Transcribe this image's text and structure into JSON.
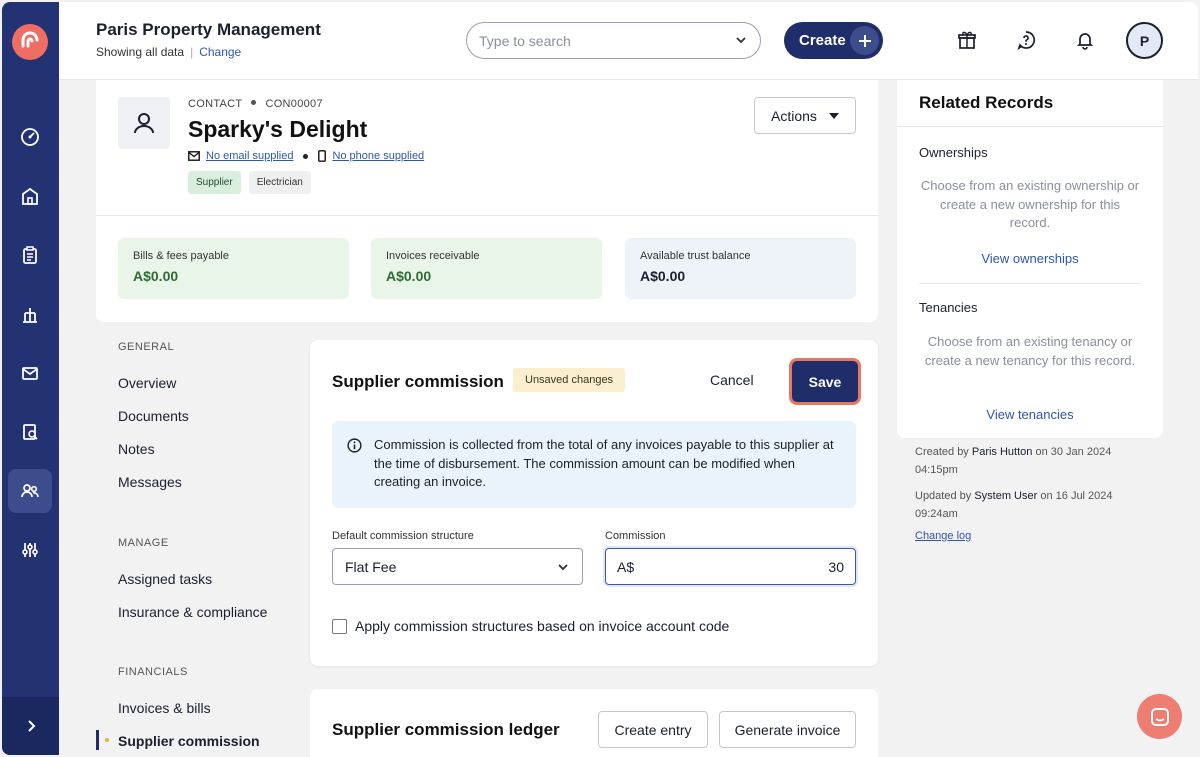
{
  "header": {
    "org_title": "Paris Property Management",
    "showing_text": "Showing all data",
    "change_link": "Change",
    "search_placeholder": "Type to search",
    "create_label": "Create",
    "avatar_initial": "P"
  },
  "contact": {
    "kind": "CONTACT",
    "code": "CON00007",
    "name": "Sparky's Delight",
    "email_text": "No email supplied",
    "phone_text": "No phone supplied",
    "tags": [
      "Supplier",
      "Electrician"
    ],
    "actions_label": "Actions",
    "stats": [
      {
        "label": "Bills & fees payable",
        "value": "A$0.00"
      },
      {
        "label": "Invoices receivable",
        "value": "A$0.00"
      },
      {
        "label": "Available trust balance",
        "value": "A$0.00"
      }
    ]
  },
  "sidenav": {
    "general_head": "GENERAL",
    "general": [
      "Overview",
      "Documents",
      "Notes",
      "Messages"
    ],
    "manage_head": "MANAGE",
    "manage": [
      "Assigned tasks",
      "Insurance & compliance"
    ],
    "financials_head": "FINANCIALS",
    "financials": [
      "Invoices & bills",
      "Supplier commission"
    ]
  },
  "commission": {
    "title": "Supplier commission",
    "unsaved_badge": "Unsaved changes",
    "cancel_label": "Cancel",
    "save_label": "Save",
    "info_text": "Commission is collected from the total of any invoices payable to this supplier at the time of disbursement. The commission amount can be modified when creating an invoice.",
    "structure_label": "Default commission structure",
    "structure_value": "Flat Fee",
    "commission_label": "Commission",
    "currency_prefix": "A$",
    "commission_value": "30",
    "checkbox_label": "Apply commission structures based on invoice account code",
    "checkbox_checked": false
  },
  "ledger": {
    "title": "Supplier commission ledger",
    "create_entry_label": "Create entry",
    "generate_invoice_label": "Generate invoice"
  },
  "related": {
    "title": "Related Records",
    "ownerships_title": "Ownerships",
    "ownerships_desc": "Choose from an existing ownership or create a new ownership for this record.",
    "ownerships_link": "View ownerships",
    "tenancies_title": "Tenancies",
    "tenancies_desc": "Choose from an existing tenancy or create a new tenancy for this record.",
    "tenancies_link": "View tenancies"
  },
  "meta": {
    "created_prefix": "Created by",
    "created_by": "Paris Hutton",
    "created_on": "on 30 Jan 2024 04:15pm",
    "updated_prefix": "Updated by",
    "updated_by": "System User",
    "updated_on": "on 16 Jul 2024 09:24am",
    "change_log": "Change log"
  },
  "colors": {
    "rail": "#233272",
    "primary": "#1f2d6b",
    "brand_coral": "#ee6e64",
    "link": "#2f56b0",
    "positive": "#2f6b34"
  }
}
